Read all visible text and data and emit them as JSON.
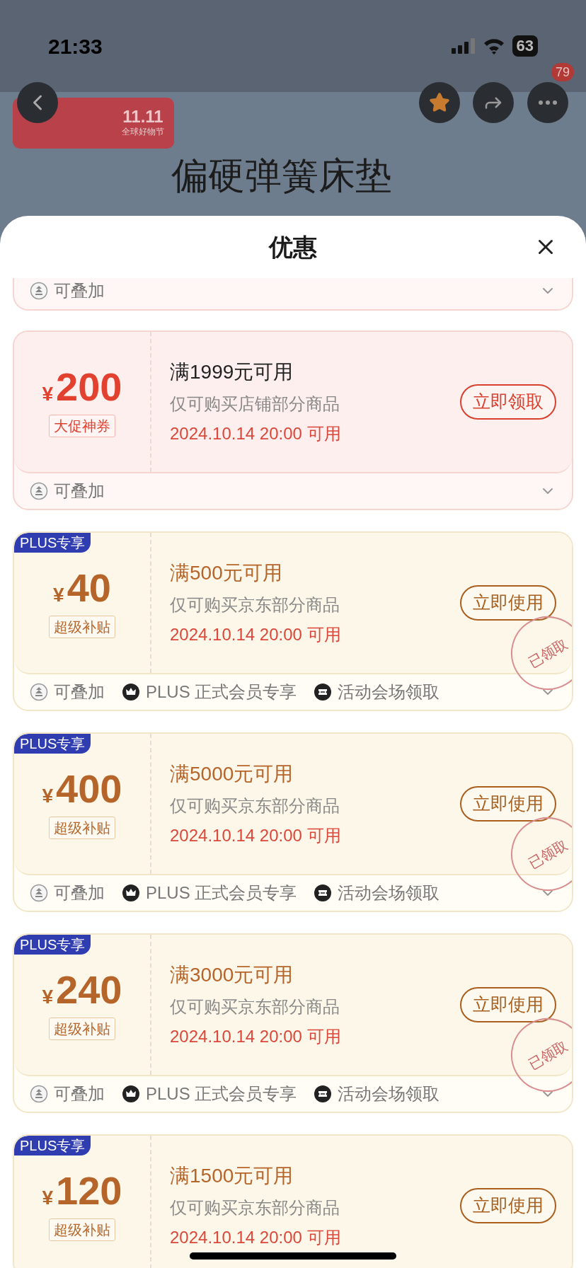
{
  "status_bar": {
    "time": "21:33",
    "battery": "63"
  },
  "page": {
    "logo": {
      "mark": "11.11",
      "caption": "全球好物节"
    },
    "heading": "偏硬弹簧床垫",
    "more_badge": "79"
  },
  "sheet": {
    "title": "优惠",
    "partial_card": {
      "tags": [
        {
          "kind": "stack",
          "label": "可叠加"
        }
      ]
    },
    "coupons": [
      {
        "kind": "promo",
        "currency": "¥",
        "amount": "200",
        "label": "大促神券",
        "condition": "满1999元可用",
        "scope": "仅可购买店铺部分商品",
        "time": "2024.10.14 20:00 可用",
        "button": "立即领取",
        "tags": [
          {
            "kind": "stack",
            "label": "可叠加"
          }
        ]
      },
      {
        "kind": "plus",
        "badge": "PLUS专享",
        "currency": "¥",
        "amount": "40",
        "label": "超级补贴",
        "condition": "满500元可用",
        "scope": "仅可购买京东部分商品",
        "time": "2024.10.14 20:00 可用",
        "button": "立即使用",
        "stamp": "已领取",
        "tags": [
          {
            "kind": "stack",
            "label": "可叠加"
          },
          {
            "kind": "plus",
            "label": "PLUS 正式会员专享"
          },
          {
            "kind": "venue",
            "label": "活动会场领取"
          }
        ]
      },
      {
        "kind": "plus",
        "badge": "PLUS专享",
        "currency": "¥",
        "amount": "400",
        "label": "超级补贴",
        "condition": "满5000元可用",
        "scope": "仅可购买京东部分商品",
        "time": "2024.10.14 20:00 可用",
        "button": "立即使用",
        "stamp": "已领取",
        "tags": [
          {
            "kind": "stack",
            "label": "可叠加"
          },
          {
            "kind": "plus",
            "label": "PLUS 正式会员专享"
          },
          {
            "kind": "venue",
            "label": "活动会场领取"
          }
        ]
      },
      {
        "kind": "plus",
        "badge": "PLUS专享",
        "currency": "¥",
        "amount": "240",
        "label": "超级补贴",
        "condition": "满3000元可用",
        "scope": "仅可购买京东部分商品",
        "time": "2024.10.14 20:00 可用",
        "button": "立即使用",
        "stamp": "已领取",
        "tags": [
          {
            "kind": "stack",
            "label": "可叠加"
          },
          {
            "kind": "plus",
            "label": "PLUS 正式会员专享"
          },
          {
            "kind": "venue",
            "label": "活动会场领取"
          }
        ]
      },
      {
        "kind": "plus",
        "badge": "PLUS专享",
        "currency": "¥",
        "amount": "120",
        "label": "超级补贴",
        "condition": "满1500元可用",
        "scope": "仅可购买京东部分商品",
        "time": "2024.10.14 20:00 可用",
        "button": "立即使用"
      }
    ]
  }
}
